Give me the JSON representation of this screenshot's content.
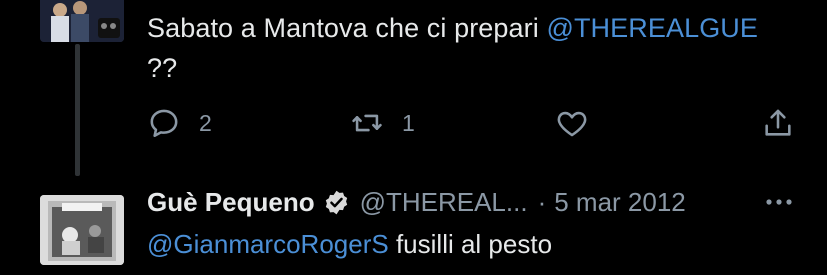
{
  "tweets": [
    {
      "text_prefix": "Sabato a Mantova che ci prepari",
      "mention": "@THEREALGUE",
      "text_suffix": "??",
      "actions": {
        "reply_count": "2",
        "retweet_count": "1",
        "like_count": "",
        "reply_icon": "reply-icon",
        "retweet_icon": "retweet-icon",
        "like_icon": "heart-icon",
        "share_icon": "share-icon"
      }
    },
    {
      "author_name": "Guè Pequeno",
      "handle": "@THEREAL...",
      "separator": "·",
      "date": "5 mar 2012",
      "mention": "@GianmarcoRogerS",
      "text": "fusilli al pesto",
      "verified_icon": "verified-badge-icon",
      "more_icon": "more-icon"
    }
  ],
  "colors": {
    "background": "#000000",
    "text": "#e7e9ea",
    "secondary": "#8b98a5",
    "mention": "#4b8fd6"
  }
}
